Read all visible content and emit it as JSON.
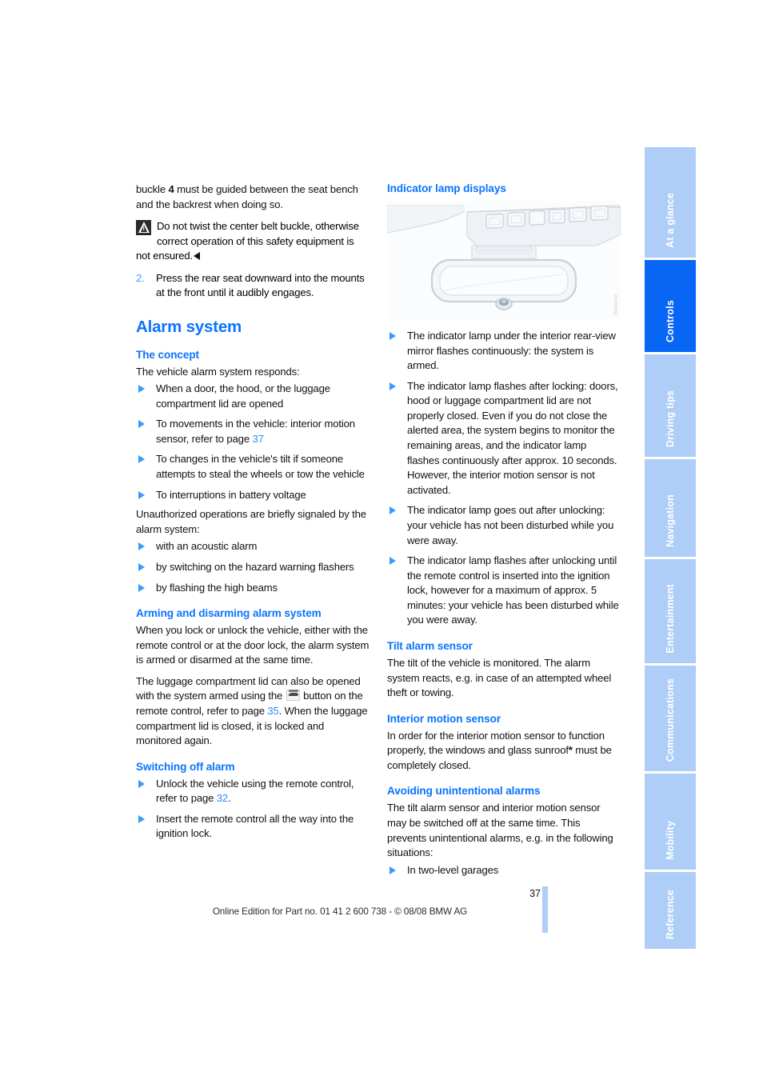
{
  "page": {
    "number": "37",
    "footer": "Online Edition for Part no. 01 41 2 600 738 - © 08/08 BMW AG"
  },
  "colors": {
    "heading_blue": "#0a74ff",
    "tab_inactive": "#aecdf7",
    "tab_active": "#0866f5",
    "bullet_blue": "#3a9bff",
    "reference_blue": "#2f8bff"
  },
  "tabs": [
    {
      "label": "At a glance",
      "active": false
    },
    {
      "label": "Controls",
      "active": true
    },
    {
      "label": "Driving tips",
      "active": false
    },
    {
      "label": "Navigation",
      "active": false
    },
    {
      "label": "Entertainment",
      "active": false
    },
    {
      "label": "Communications",
      "active": false
    },
    {
      "label": "Mobility",
      "active": false
    },
    {
      "label": "Reference",
      "active": false
    }
  ],
  "left_column": {
    "continued_paragraph_pre": "buckle ",
    "continued_paragraph_bold": "4",
    "continued_paragraph_post": " must be guided between the seat bench and the backrest when doing so.",
    "warning_note": "Do not twist the center belt buckle, otherwise correct operation of this safety equipment is not ensured.",
    "step_2_number": "2.",
    "step_2_text": "Press the rear seat downward into the mounts at the front until it audibly engages.",
    "alarm_system_title": "Alarm system",
    "the_concept_title": "The concept",
    "the_concept_intro": "The vehicle alarm system responds:",
    "concept_bullets": [
      {
        "text": "When a door, the hood, or the luggage compartment lid are opened"
      },
      {
        "text_pre": "To movements in the vehicle: interior motion sensor, refer to page ",
        "ref": "37",
        "text_post": ""
      },
      {
        "text": "To changes in the vehicle's tilt if someone attempts to steal the wheels or tow the vehicle"
      },
      {
        "text": "To interruptions in battery voltage"
      }
    ],
    "unauthorized_intro": "Unauthorized operations are briefly signaled by the alarm system:",
    "signal_bullets": [
      {
        "text": "with an acoustic alarm"
      },
      {
        "text": "by switching on the hazard warning flashers"
      },
      {
        "text": "by flashing the high beams"
      }
    ],
    "arming_title": "Arming and disarming alarm system",
    "arming_p1": "When you lock or unlock the vehicle, either with the remote control or at the door lock, the alarm system is armed or disarmed at the same time.",
    "arming_p2_pre": "The luggage compartment lid can also be opened with the system armed using the ",
    "arming_p2_mid": " button on the remote control, refer to page ",
    "arming_p2_ref": "35",
    "arming_p2_post": ". When the luggage compartment lid is closed, it is locked and monitored again.",
    "switching_off_title": "Switching off alarm",
    "switching_off_bullets": [
      {
        "text_pre": "Unlock the vehicle using the remote control, refer to page ",
        "ref": "32",
        "text_post": "."
      },
      {
        "text_pre": "Insert the remote control all the way into the ignition lock.",
        "ref": "",
        "text_post": ""
      }
    ]
  },
  "right_column": {
    "indicator_title": "Indicator lamp displays",
    "figure_alt": "Interior rear-view mirror with overhead console",
    "figure_code": "BMW0748",
    "indicator_bullets": [
      {
        "text": "The indicator lamp under the interior rear-view mirror flashes continuously: the system is armed."
      },
      {
        "text": "The indicator lamp flashes after locking: doors, hood or luggage compartment lid are not properly closed. Even if you do not close the alerted area, the system begins to monitor the remaining areas, and the indicator lamp flashes continuously after approx. 10 seconds. However, the interior motion sensor is not activated."
      },
      {
        "text": "The indicator lamp goes out after unlocking: your vehicle has not been disturbed while you were away."
      },
      {
        "text": "The indicator lamp flashes after unlocking until the remote control is inserted into the ignition lock, however for a maximum of approx. 5 minutes: your vehicle has been disturbed while you were away."
      }
    ],
    "tilt_title": "Tilt alarm sensor",
    "tilt_text": "The tilt of the vehicle is monitored. The alarm system reacts, e.g. in case of an attempted wheel theft or towing.",
    "interior_title": "Interior motion sensor",
    "interior_text_pre": "In order for the interior motion sensor to function properly, the windows and glass sunroof",
    "interior_text_asterisk": "*",
    "interior_text_post": " must be completely closed.",
    "avoiding_title": "Avoiding unintentional alarms",
    "avoiding_text": "The tilt alarm sensor and interior motion sensor may be switched off at the same time. This prevents unintentional alarms, e.g. in the following situations:",
    "avoiding_bullets": [
      {
        "text": "In two-level garages"
      }
    ]
  }
}
